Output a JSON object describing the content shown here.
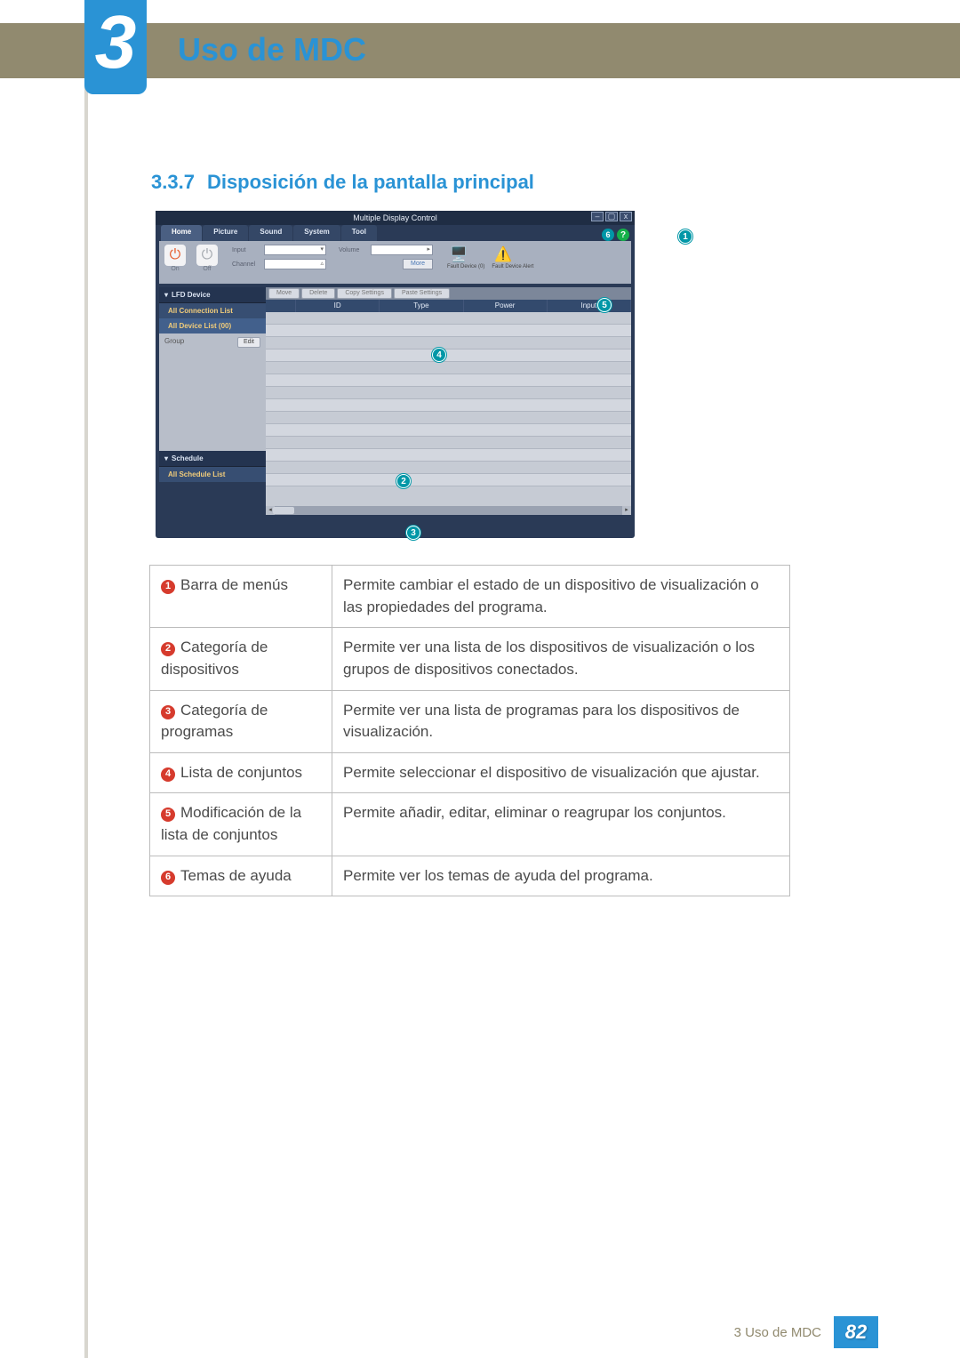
{
  "chapter": {
    "num": "3",
    "title": "Uso de MDC"
  },
  "section": {
    "num": "3.3.7",
    "title": "Disposición de la pantalla principal"
  },
  "app": {
    "window_title": "Multiple Display Control",
    "tabs": [
      "Home",
      "Picture",
      "Sound",
      "System",
      "Tool"
    ],
    "power": {
      "on": "On",
      "off": "Off"
    },
    "field_input": "Input",
    "field_channel": "Channel",
    "field_volume": "Volume",
    "more": "More",
    "fault1": "Fault Device (0)",
    "fault2": "Fault Device Alert",
    "lfd_device": "LFD Device",
    "all_conn": "All Connection List",
    "all_dev": "All Device List (00)",
    "group": "Group",
    "edit": "Edit",
    "schedule": "Schedule",
    "all_sched": "All Schedule List",
    "tb_move": "Move",
    "tb_delete": "Delete",
    "tb_copy": "Copy Settings",
    "tb_paste": "Paste Settings",
    "hdr_id": "ID",
    "hdr_type": "Type",
    "hdr_power": "Power",
    "hdr_input": "Input"
  },
  "legend": [
    {
      "n": "1",
      "label": "Barra de menús",
      "desc": "Permite cambiar el estado de un dispositivo de visualización o las propiedades del programa."
    },
    {
      "n": "2",
      "label": "Categoría de dispositivos",
      "desc": "Permite ver una lista de los dispositivos de visualización o los grupos de dispositivos conectados."
    },
    {
      "n": "3",
      "label": "Categoría de programas",
      "desc": "Permite ver una lista de programas para los dispositivos de visualización."
    },
    {
      "n": "4",
      "label": "Lista de conjuntos",
      "desc": "Permite seleccionar el dispositivo de visualización que ajustar."
    },
    {
      "n": "5",
      "label": "Modificación de la lista de conjuntos",
      "desc": "Permite añadir, editar, eliminar o reagrupar los conjuntos."
    },
    {
      "n": "6",
      "label": "Temas de ayuda",
      "desc": "Permite ver los temas de ayuda del programa."
    }
  ],
  "footer": {
    "text": "3 Uso de MDC",
    "page": "82"
  }
}
